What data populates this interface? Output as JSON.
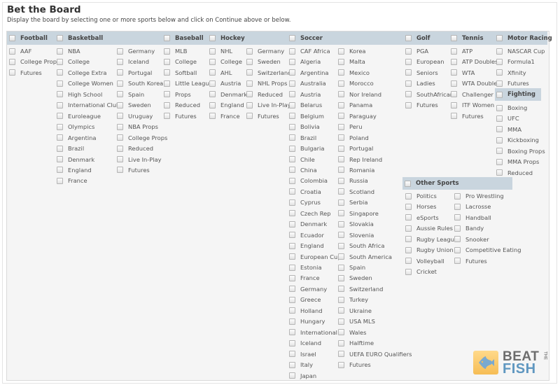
{
  "title": "Bet the Board",
  "subtitle": "Display the board by selecting one or more sports below and click on Continue above or below.",
  "headers": [
    "Football",
    "Basketball",
    "Baseball",
    "Hockey",
    "Soccer",
    "Golf",
    "Tennis",
    "Motor Racing"
  ],
  "football": [
    "AAF",
    "College Props",
    "Futures"
  ],
  "basketball_col1": [
    "NBA",
    "College",
    "College Extra",
    "College Women",
    "High School",
    "International Clubs",
    "Euroleague",
    "Olympics",
    "Argentina",
    "Brazil",
    "Denmark",
    "England",
    "France"
  ],
  "basketball_col2": [
    "Germany",
    "Iceland",
    "Portugal",
    "South Korea",
    "Spain",
    "Sweden",
    "Uruguay",
    "NBA Props",
    "College Props",
    "Reduced",
    "Live In-Play",
    "Futures"
  ],
  "baseball": [
    "MLB",
    "College",
    "Softball",
    "Little League",
    "Props",
    "Reduced",
    "Futures"
  ],
  "hockey_col1": [
    "NHL",
    "College",
    "AHL",
    "Austria",
    "Denmark",
    "England",
    "France"
  ],
  "hockey_col2": [
    "Germany",
    "Sweden",
    "Switzerland",
    "NHL Props",
    "Reduced",
    "Live In-Play",
    "Futures"
  ],
  "soccer_col1": [
    "CAF Africa",
    "Algeria",
    "Argentina",
    "Australia",
    "Austria",
    "Belarus",
    "Belgium",
    "Bolivia",
    "Brazil",
    "Bulgaria",
    "Chile",
    "China",
    "Colombia",
    "Croatia",
    "Cyprus",
    "Czech Rep",
    "Denmark",
    "Ecuador",
    "England",
    "European Cup",
    "Estonia",
    "France",
    "Germany",
    "Greece",
    "Holland",
    "Hungary",
    "International",
    "Iceland",
    "Israel",
    "Italy",
    "Japan"
  ],
  "soccer_col2": [
    "Korea",
    "Malta",
    "Mexico",
    "Morocco",
    "Nor Ireland",
    "Panama",
    "Paraguay",
    "Peru",
    "Poland",
    "Portugal",
    "Rep Ireland",
    "Romania",
    "Russia",
    "Scotland",
    "Serbia",
    "Singapore",
    "Slovakia",
    "Slovenia",
    "South Africa",
    "South America",
    "Spain",
    "Sweden",
    "Switzerland",
    "Turkey",
    "Ukraine",
    "USA MLS",
    "Wales",
    "Halftime",
    "UEFA EURO Qualifiers",
    "Futures"
  ],
  "golf": [
    "PGA",
    "European",
    "Seniors",
    "Ladies",
    "SouthAfrican",
    "Futures"
  ],
  "tennis": [
    "ATP",
    "ATP Doubles",
    "WTA",
    "WTA Doubles",
    "Challenger",
    "ITF Women",
    "Futures"
  ],
  "motor_racing": [
    "NASCAR Cup",
    "Formula1",
    "Xfinity",
    "Futures"
  ],
  "fighting_header": "Fighting",
  "fighting": [
    "Boxing",
    "UFC",
    "MMA",
    "Kickboxing",
    "Boxing Props",
    "MMA Props",
    "Reduced"
  ],
  "other_header": "Other Sports",
  "other_col1": [
    "Politics",
    "Horses",
    "eSports",
    "Aussie Rules",
    "Rugby League",
    "Rugby Union",
    "Volleyball",
    "Cricket"
  ],
  "other_col2": [
    "Pro Wrestling",
    "Lacrosse",
    "Handball",
    "Bandy",
    "Snooker",
    "Competitive Eating",
    "Futures"
  ],
  "logo": {
    "beat": "BEAT",
    "the": "THE",
    "fish": "FISH"
  }
}
